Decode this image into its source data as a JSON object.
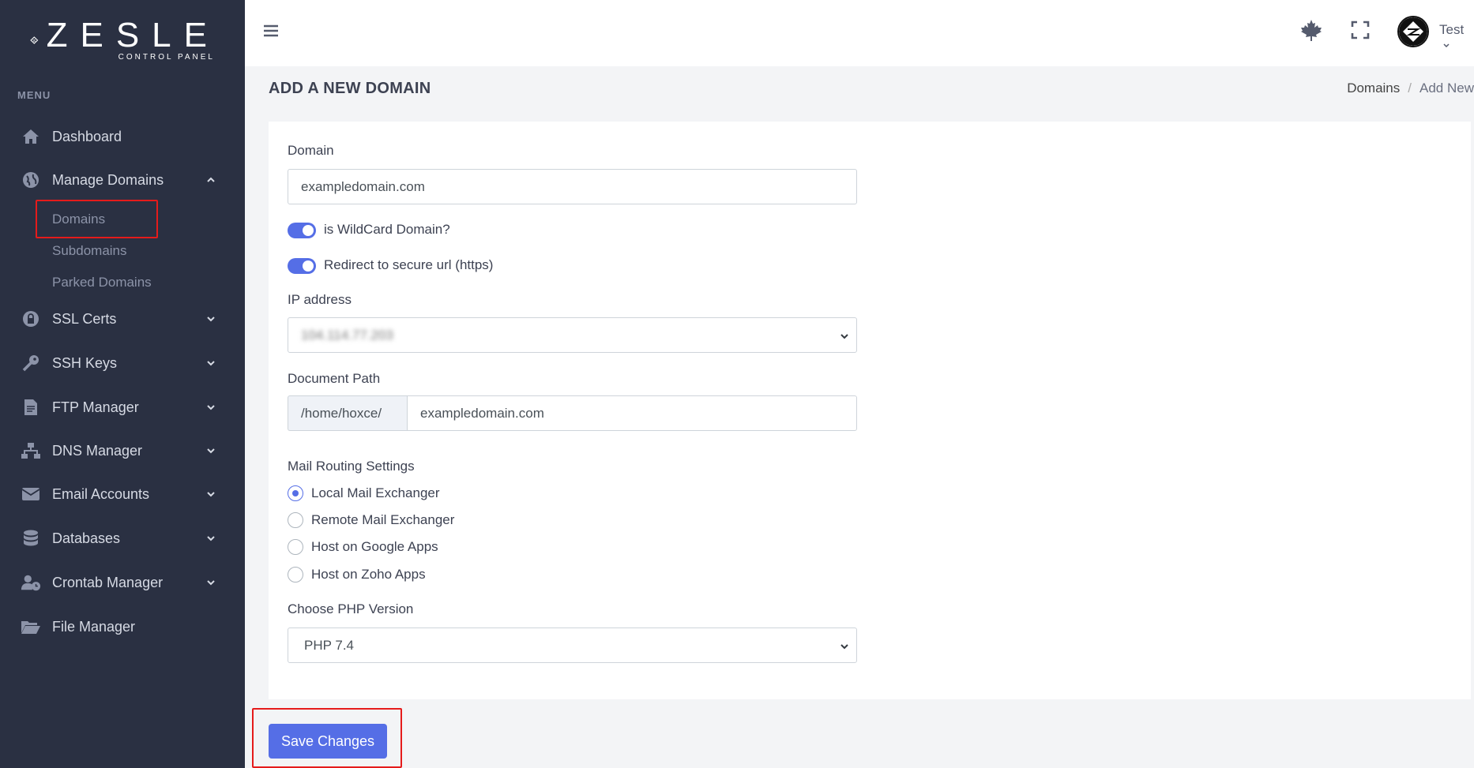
{
  "brand": {
    "name": "ZESLE",
    "subtitle": "CONTROL PANEL"
  },
  "sidebar": {
    "menu_title": "MENU",
    "items": [
      {
        "label": "Dashboard",
        "icon": "home-icon"
      },
      {
        "label": "Manage Domains",
        "icon": "globe-icon",
        "expanded": true
      },
      {
        "label": "SSL Certs",
        "icon": "lock-icon"
      },
      {
        "label": "SSH Keys",
        "icon": "key-icon"
      },
      {
        "label": "FTP Manager",
        "icon": "file-icon"
      },
      {
        "label": "DNS Manager",
        "icon": "sitemap-icon"
      },
      {
        "label": "Email Accounts",
        "icon": "envelope-icon"
      },
      {
        "label": "Databases",
        "icon": "database-icon"
      },
      {
        "label": "Crontab Manager",
        "icon": "user-clock-icon"
      },
      {
        "label": "File Manager",
        "icon": "folder-open-icon"
      }
    ],
    "sub_items": [
      "Domains",
      "Subdomains",
      "Parked Domains"
    ]
  },
  "topbar": {
    "user_name": "Test"
  },
  "page": {
    "title": "ADD A NEW DOMAIN",
    "breadcrumb": [
      "Domains",
      "Add New"
    ]
  },
  "form": {
    "domain_label": "Domain",
    "domain_value": "exampledomain.com",
    "wildcard_label": "is WildCard Domain?",
    "wildcard_on": true,
    "redirect_label": "Redirect to secure url (https)",
    "redirect_on": true,
    "ip_label": "IP address",
    "ip_value": "104.114.77.203",
    "doc_path_label": "Document Path",
    "doc_path_prefix": "/home/hoxce/",
    "doc_path_value": "exampledomain.com",
    "mail_label": "Mail Routing Settings",
    "mail_options": [
      "Local Mail Exchanger",
      "Remote Mail Exchanger",
      "Host on Google Apps",
      "Host on Zoho Apps"
    ],
    "mail_selected": "Local Mail Exchanger",
    "php_label": "Choose PHP Version",
    "php_value": "PHP 7.4"
  },
  "actions": {
    "save_label": "Save Changes"
  },
  "colors": {
    "sidebar_bg": "#2a3042",
    "accent": "#556ee6",
    "highlight": "#e51b1b"
  }
}
